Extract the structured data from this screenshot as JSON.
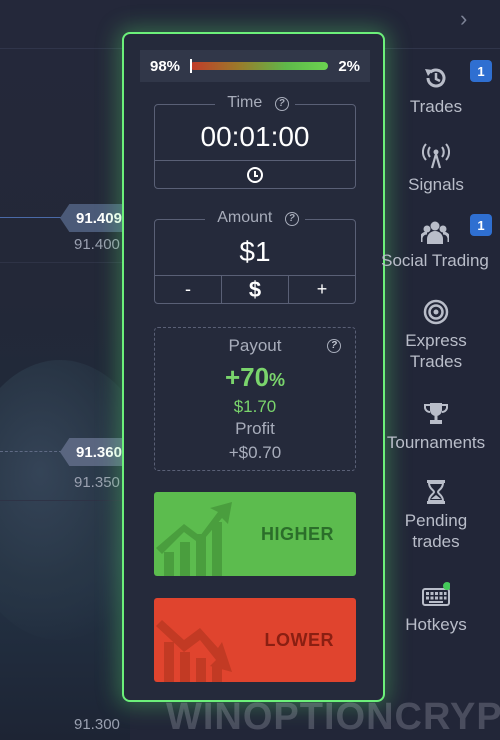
{
  "chart": {
    "ticks": [
      "91.400",
      "91.350",
      "91.300"
    ],
    "price_tags": [
      "91.409",
      "91.360"
    ]
  },
  "sentiment": {
    "left": "98%",
    "right": "2%"
  },
  "time": {
    "label": "Time",
    "value": "00:01:00"
  },
  "amount": {
    "label": "Amount",
    "value": "$1",
    "minus": "-",
    "currency": "$",
    "plus": "+"
  },
  "payout": {
    "label": "Payout",
    "percent": "+70",
    "percent_sign": "%",
    "amount": "$1.70",
    "profit_label": "Profit",
    "profit_value": "+$0.70"
  },
  "buttons": {
    "higher": "HIGHER",
    "lower": "LOWER"
  },
  "sidebar": {
    "items": [
      {
        "label": "Trades",
        "icon": "history-icon",
        "badge": "1"
      },
      {
        "label": "Signals",
        "icon": "signal-tower-icon"
      },
      {
        "label": "Social Trading",
        "icon": "users-icon",
        "badge": "1"
      },
      {
        "label": "Express Trades",
        "icon": "target-icon"
      },
      {
        "label": "Tournaments",
        "icon": "trophy-icon"
      },
      {
        "label": "Pending trades",
        "icon": "hourglass-icon"
      },
      {
        "label": "Hotkeys",
        "icon": "keyboard-icon"
      }
    ]
  },
  "watermark": "WINOPTIONCRYPTO.COM",
  "colors": {
    "accent_green": "#5cbc4e",
    "accent_red": "#e0442e",
    "highlight": "#6cf07a",
    "badge": "#2f6fd1"
  }
}
